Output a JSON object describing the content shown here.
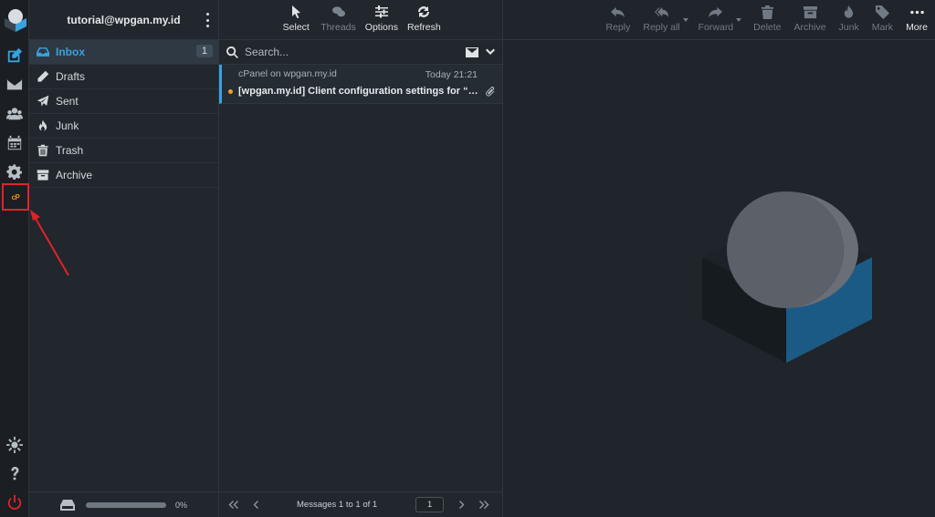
{
  "account": {
    "email": "tutorial@wpgan.my.id"
  },
  "rail": {
    "items": [
      {
        "name": "compose-icon"
      },
      {
        "name": "mail-icon"
      },
      {
        "name": "contacts-icon"
      },
      {
        "name": "calendar-icon"
      },
      {
        "name": "settings-icon"
      },
      {
        "name": "cpanel-icon",
        "label": "cP"
      }
    ],
    "bottom": [
      {
        "name": "theme-icon"
      },
      {
        "name": "help-icon"
      },
      {
        "name": "logout-icon"
      }
    ]
  },
  "folders": [
    {
      "label": "Inbox",
      "count": "1",
      "icon": "inbox-icon",
      "active": true
    },
    {
      "label": "Drafts",
      "icon": "pencil-icon"
    },
    {
      "label": "Sent",
      "icon": "paper-plane-icon"
    },
    {
      "label": "Junk",
      "icon": "fire-icon"
    },
    {
      "label": "Trash",
      "icon": "trash-icon"
    },
    {
      "label": "Archive",
      "icon": "archive-icon"
    }
  ],
  "quota": {
    "text": "0%",
    "fill": 0
  },
  "list_toolbar": {
    "select": "Select",
    "threads": "Threads",
    "options": "Options",
    "refresh": "Refresh"
  },
  "search": {
    "placeholder": "Search..."
  },
  "messages": [
    {
      "from": "cPanel on wpgan.my.id",
      "date": "Today 21:21",
      "subject": "[wpgan.my.id] Client configuration settings for “tutori…",
      "unread": true,
      "attachment": true
    }
  ],
  "pager": {
    "status": "Messages 1 to 1 of 1",
    "page": "1"
  },
  "reading_toolbar": {
    "reply": "Reply",
    "reply_all": "Reply all",
    "forward": "Forward",
    "delete": "Delete",
    "archive": "Archive",
    "junk": "Junk",
    "mark": "Mark",
    "more": "More"
  },
  "colors": {
    "accent": "#37a3e0",
    "highlight": "#e0222a",
    "unread_dot": "#f1a421",
    "cpanel": "#f08a1c"
  }
}
